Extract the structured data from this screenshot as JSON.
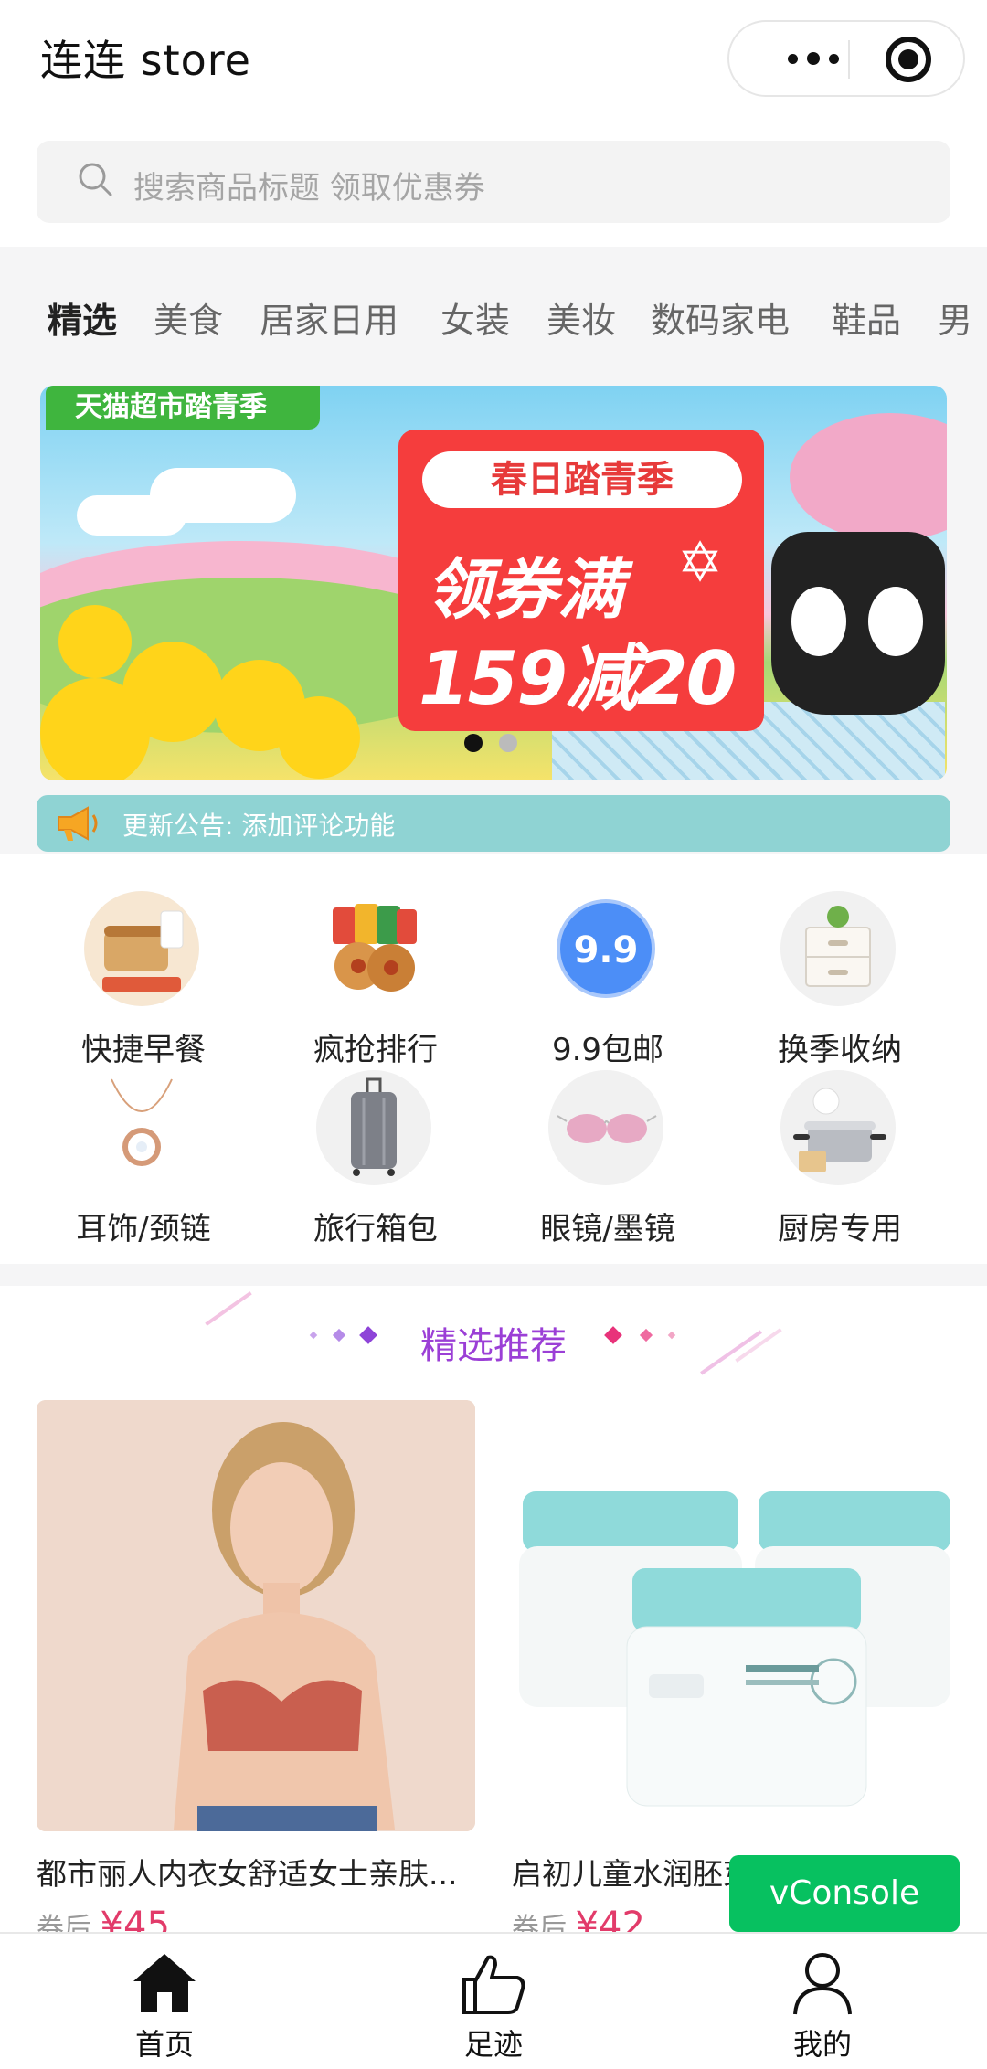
{
  "header": {
    "title": "连连 store"
  },
  "search": {
    "placeholder": "搜索商品标题 领取优惠券"
  },
  "tabs": [
    {
      "label": "精选",
      "active": true
    },
    {
      "label": "美食"
    },
    {
      "label": "居家日用"
    },
    {
      "label": "女装"
    },
    {
      "label": "美妆"
    },
    {
      "label": "数码家电"
    },
    {
      "label": "鞋品"
    },
    {
      "label": "男"
    }
  ],
  "banner": {
    "tag": "天猫超市踏青季",
    "headline": "春日踏青季",
    "line1": "领券满",
    "line2": "159减20",
    "slides": 2,
    "active_slide": 1
  },
  "notice": {
    "text": "更新公告: 添加评论功能"
  },
  "categories": [
    {
      "label": "快捷早餐",
      "icon": "breakfast-icon"
    },
    {
      "label": "疯抢排行",
      "icon": "cookies-icon"
    },
    {
      "label": "9.9包邮",
      "icon": "nine-nine-icon",
      "badge": "9.9"
    },
    {
      "label": "换季收纳",
      "icon": "storage-box-icon"
    },
    {
      "label": "耳饰/颈链",
      "icon": "necklace-icon"
    },
    {
      "label": "旅行箱包",
      "icon": "suitcase-icon"
    },
    {
      "label": "眼镜/墨镜",
      "icon": "sunglasses-icon"
    },
    {
      "label": "厨房专用",
      "icon": "kitchen-pot-icon"
    }
  ],
  "recommend": {
    "title": "精选推荐"
  },
  "products": [
    {
      "name": "都市丽人内衣女舒适女士亲肤...",
      "coupon_label": "券后",
      "price": "¥45"
    },
    {
      "name": "启初儿童水润胚芽面霜",
      "coupon_label": "券后",
      "price": "¥42"
    }
  ],
  "vconsole": {
    "label": "vConsole"
  },
  "tabbar": [
    {
      "label": "首页",
      "icon": "home-icon"
    },
    {
      "label": "足迹",
      "icon": "thumbs-up-icon"
    },
    {
      "label": "我的",
      "icon": "user-icon"
    }
  ],
  "colors": {
    "accent": "#07c160",
    "notice": "#8fd3d3",
    "price": "#e23b6a",
    "recommend_title": "#9b3fd6"
  }
}
